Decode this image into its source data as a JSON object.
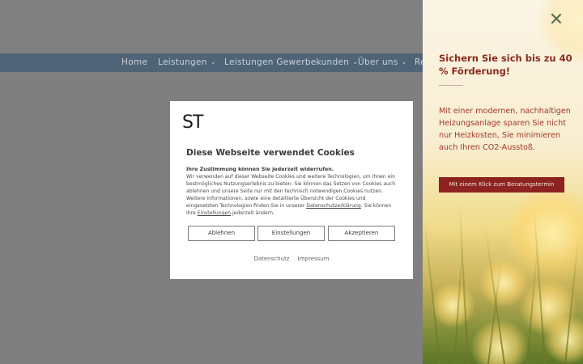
{
  "nav": {
    "items": [
      {
        "label": "Home",
        "chevron": false
      },
      {
        "label": "Leistungen",
        "chevron": true
      },
      {
        "label": "Leistungen Gewerbekunden",
        "chevron": true
      },
      {
        "label": "Über uns",
        "chevron": true
      },
      {
        "label": "Re",
        "chevron": false
      }
    ]
  },
  "cookie": {
    "logo_text": "ST",
    "title": "Diese Webseite verwendet Cookies",
    "subtitle": "Ihre Zustimmung können Sie jederzeit widerrufen.",
    "body_1": "Wir verwenden auf dieser Webseite Cookies und weitere Technologien, um Ihnen ein bestmögliches Nutzungserlebnis zu bieten. Sie können das Setzen von Cookies auch ablehnen und unsere Seite nur mit den technisch notwendigen Cookies nutzen. Weitere Informationen, sowie eine detaillierte Übersicht der Cookies und eingesetzten Technologien finden Sie in unserer ",
    "privacy_link": "Datenschutzerklärung",
    "body_2": ". Sie können Ihre ",
    "settings_link": "Einstellungen",
    "body_3": " jederzeit ändern.",
    "buttons": {
      "reject": "Ablehnen",
      "settings": "Einstellungen",
      "accept": "Akzeptieren"
    },
    "footer": {
      "privacy": "Datenschutz",
      "imprint": "Impressum"
    }
  },
  "panel": {
    "title": "Sichern Sie sich bis zu 40 % Förderung!",
    "text": "Mit einer modernen, nachhaltigen Heizungsanlage sparen Sie nicht nur Heizkosten, Sie minimieren auch Ihren CO2-Ausstoß.",
    "cta": "Mit einem Klick zum Beratungstermin"
  },
  "colors": {
    "nav_bg": "#4f6477",
    "accent_red": "#8c2321",
    "panel_text": "#a0382b"
  }
}
